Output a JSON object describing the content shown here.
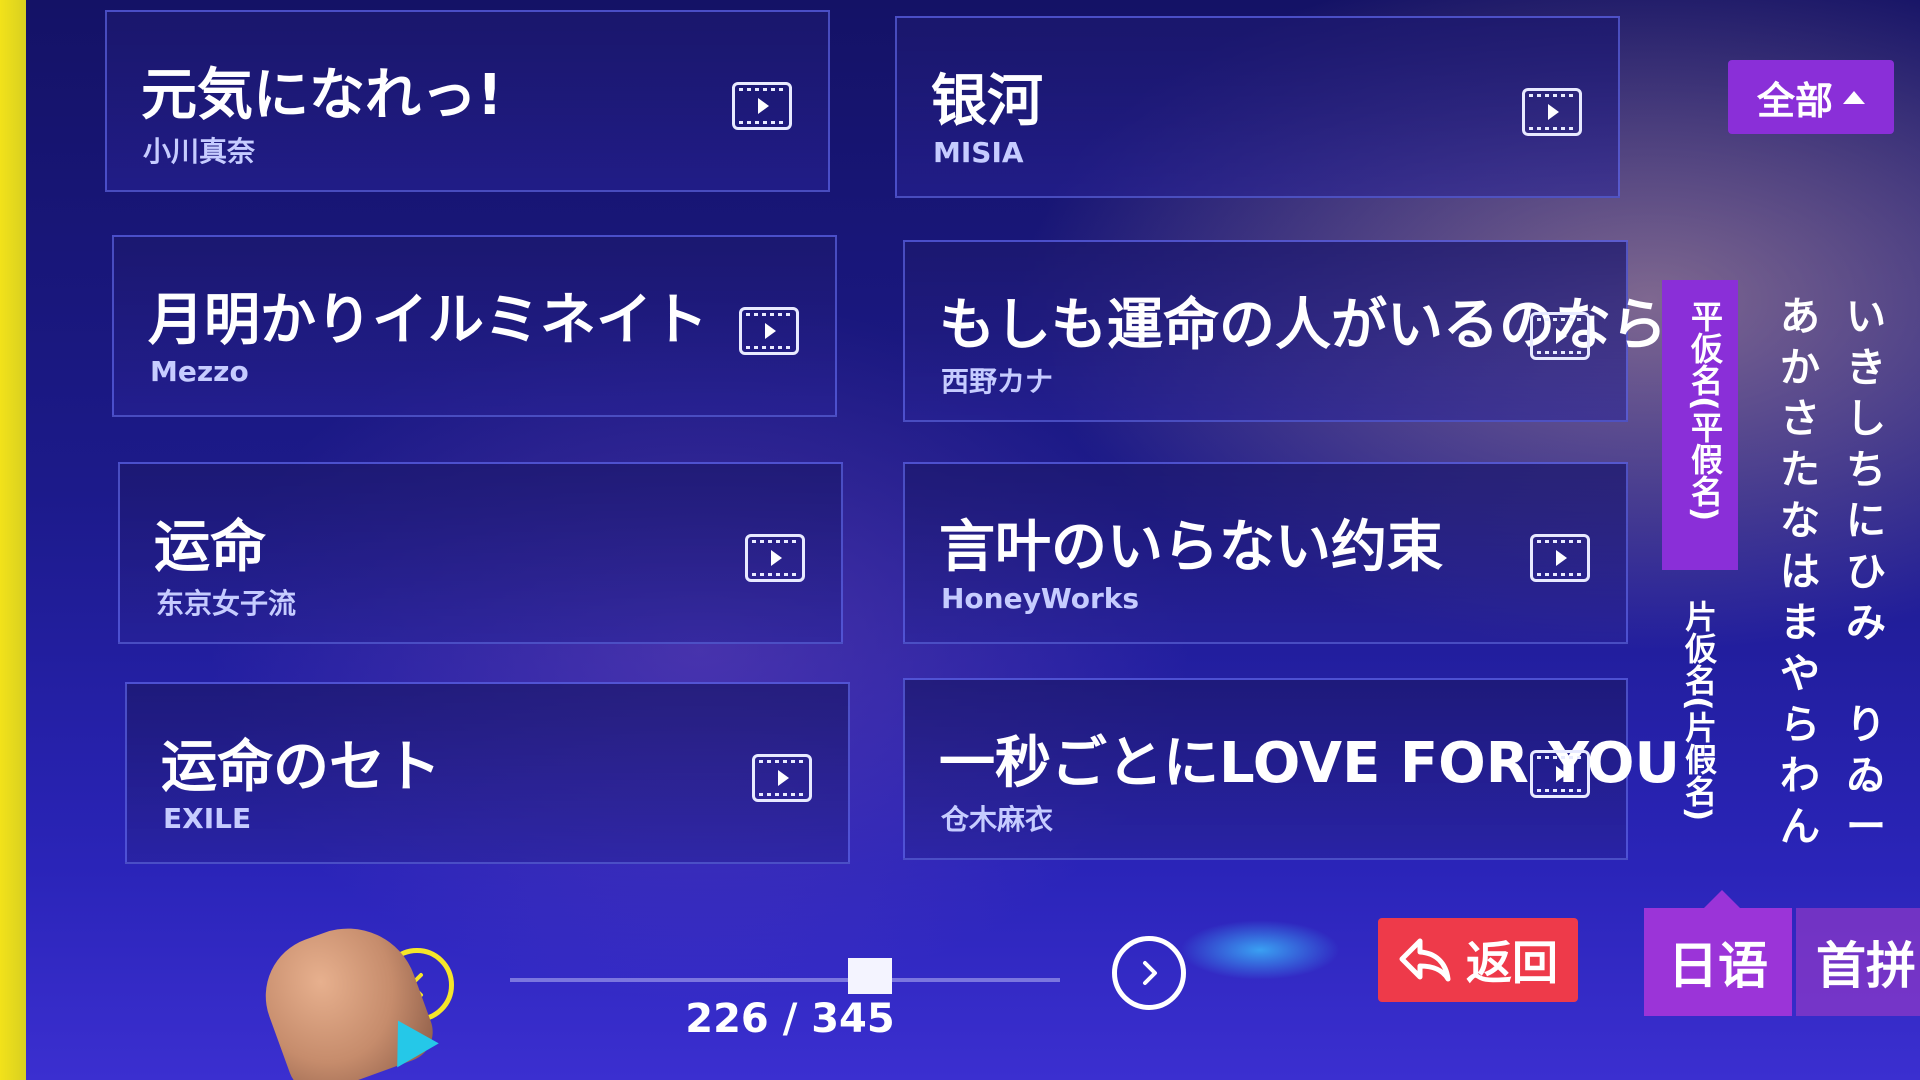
{
  "songs": [
    {
      "title": "元気になれっ!",
      "artist": "小川真奈"
    },
    {
      "title": "银河",
      "artist": "MISIA"
    },
    {
      "title": "月明かりイルミネイト",
      "artist": "Mezzo"
    },
    {
      "title": "もしも運命の人がいるのなら",
      "artist": "西野カナ"
    },
    {
      "title": "运命",
      "artist": "东京女子流"
    },
    {
      "title": "言叶のいらない约束",
      "artist": "HoneyWorks"
    },
    {
      "title": "运命のセト",
      "artist": "EXILE"
    },
    {
      "title": "一秒ごとにLOVE FOR YOU",
      "artist": "仓木麻衣"
    }
  ],
  "filter": {
    "all_label": "全部"
  },
  "kana_panel": {
    "hiragana_label": "平仮名(平假名)",
    "katakana_label": "片仮名(片假名)",
    "column_a": [
      "あ",
      "か",
      "さ",
      "た",
      "な",
      "は",
      "ま",
      "や",
      "ら",
      "わ",
      "ん"
    ],
    "column_i": [
      "い",
      "き",
      "し",
      "ち",
      "に",
      "ひ",
      "み",
      "",
      "り",
      "ゐ",
      "ー"
    ]
  },
  "tabs": {
    "japanese": "日语",
    "pinyin": "首拼"
  },
  "actions": {
    "back_label": "返回"
  },
  "pagination": {
    "current": 226,
    "total": 345,
    "text": "226 / 345"
  },
  "icons": {
    "play": "video-play-icon",
    "prev": "chevron-left-icon",
    "next": "chevron-right-icon",
    "back": "return-arrow-icon"
  }
}
